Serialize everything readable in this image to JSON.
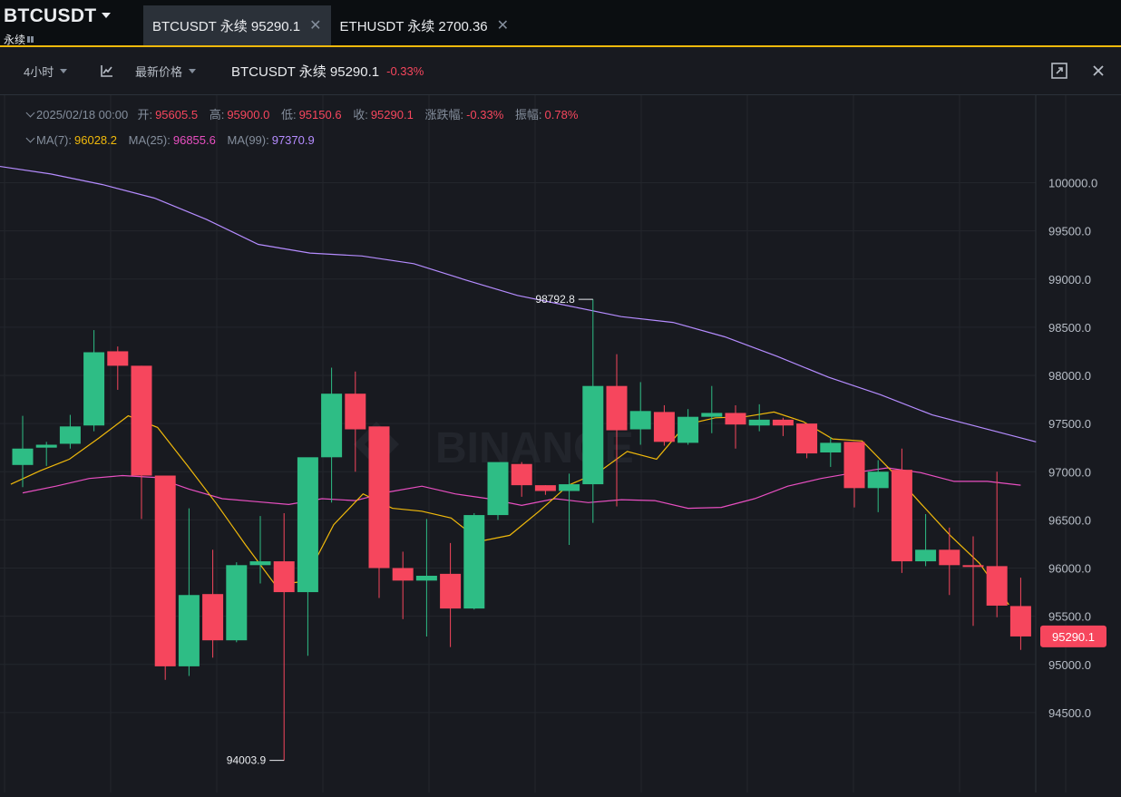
{
  "header": {
    "symbol": "BTCUSDT",
    "symbol_sub": "永续",
    "tabs": [
      {
        "label": "BTCUSDT 永续 95290.1",
        "active": true
      },
      {
        "label": "ETHUSDT 永续 2700.36",
        "active": false
      }
    ],
    "close_glyph": "✕"
  },
  "toolbar": {
    "interval": "4小时",
    "price_type": "最新价格",
    "title": "BTCUSDT 永续 95290.1",
    "change": "-0.33%"
  },
  "ohlc": {
    "date": "2025/02/18 00:00",
    "open_label": "开:",
    "open": "95605.5",
    "high_label": "高:",
    "high": "95900.0",
    "low_label": "低:",
    "low": "95150.6",
    "close_label": "收:",
    "close": "95290.1",
    "change_label": "涨跌幅:",
    "change": "-0.33%",
    "amplitude_label": "振幅:",
    "amplitude": "0.78%"
  },
  "ma": {
    "ma7_label": "MA(7):",
    "ma7": "96028.2",
    "ma25_label": "MA(25):",
    "ma25": "96855.6",
    "ma99_label": "MA(99):",
    "ma99": "97370.9"
  },
  "watermark": "BINANCE",
  "colors": {
    "up": "#2ebd85",
    "down": "#f6465d",
    "ma7": "#f0b90b",
    "ma25": "#e84fc1",
    "ma99": "#b58cff",
    "accent": "#f0b90b"
  },
  "chart_data": {
    "type": "candlestick",
    "ylim": [
      94000,
      100400
    ],
    "y_ticks": [
      "100000.0",
      "99500.0",
      "99000.0",
      "98500.0",
      "98000.0",
      "97500.0",
      "97000.0",
      "96500.0",
      "96000.0",
      "95500.0",
      "95000.0",
      "94500.0"
    ],
    "last_price": "95290.1",
    "annotations": {
      "high": "98792.8",
      "low": "94003.9"
    },
    "candles": [
      {
        "o": 97070,
        "h": 97580,
        "l": 96840,
        "c": 97240
      },
      {
        "o": 97250,
        "h": 97310,
        "l": 97060,
        "c": 97280
      },
      {
        "o": 97290,
        "h": 97590,
        "l": 97240,
        "c": 97470
      },
      {
        "o": 97480,
        "h": 98470,
        "l": 97420,
        "c": 98240
      },
      {
        "o": 98250,
        "h": 98300,
        "l": 97850,
        "c": 98100
      },
      {
        "o": 98100,
        "h": 98100,
        "l": 96510,
        "c": 96960
      },
      {
        "o": 96960,
        "h": 96960,
        "l": 94840,
        "c": 94980
      },
      {
        "o": 94980,
        "h": 96620,
        "l": 94880,
        "c": 95720
      },
      {
        "o": 95730,
        "h": 96190,
        "l": 95070,
        "c": 95250
      },
      {
        "o": 95250,
        "h": 96060,
        "l": 95230,
        "c": 96030
      },
      {
        "o": 96030,
        "h": 96540,
        "l": 95840,
        "c": 96070
      },
      {
        "o": 96070,
        "h": 96570,
        "l": 94004,
        "c": 95750
      },
      {
        "o": 95750,
        "h": 96520,
        "l": 95090,
        "c": 97150
      },
      {
        "o": 97150,
        "h": 98080,
        "l": 96680,
        "c": 97810
      },
      {
        "o": 97810,
        "h": 98040,
        "l": 97000,
        "c": 97440
      },
      {
        "o": 97470,
        "h": 97470,
        "l": 95690,
        "c": 96000
      },
      {
        "o": 96000,
        "h": 96170,
        "l": 95470,
        "c": 95870
      },
      {
        "o": 95870,
        "h": 96510,
        "l": 95290,
        "c": 95920
      },
      {
        "o": 95940,
        "h": 96260,
        "l": 95180,
        "c": 95580
      },
      {
        "o": 95580,
        "h": 96570,
        "l": 95570,
        "c": 96550
      },
      {
        "o": 96550,
        "h": 97080,
        "l": 96500,
        "c": 97100
      },
      {
        "o": 97080,
        "h": 97100,
        "l": 96740,
        "c": 96860
      },
      {
        "o": 96860,
        "h": 96860,
        "l": 96760,
        "c": 96800
      },
      {
        "o": 96800,
        "h": 96980,
        "l": 96240,
        "c": 96870
      },
      {
        "o": 96870,
        "h": 98790,
        "l": 96470,
        "c": 97890
      },
      {
        "o": 97890,
        "h": 98220,
        "l": 96640,
        "c": 97430
      },
      {
        "o": 97440,
        "h": 97930,
        "l": 97280,
        "c": 97630
      },
      {
        "o": 97620,
        "h": 97690,
        "l": 97270,
        "c": 97310
      },
      {
        "o": 97300,
        "h": 97650,
        "l": 97280,
        "c": 97570
      },
      {
        "o": 97570,
        "h": 97890,
        "l": 97400,
        "c": 97610
      },
      {
        "o": 97610,
        "h": 97690,
        "l": 97240,
        "c": 97490
      },
      {
        "o": 97480,
        "h": 97700,
        "l": 97420,
        "c": 97540
      },
      {
        "o": 97540,
        "h": 97560,
        "l": 97370,
        "c": 97480
      },
      {
        "o": 97500,
        "h": 97500,
        "l": 97140,
        "c": 97190
      },
      {
        "o": 97200,
        "h": 97360,
        "l": 97050,
        "c": 97300
      },
      {
        "o": 97310,
        "h": 97310,
        "l": 96630,
        "c": 96830
      },
      {
        "o": 96830,
        "h": 97120,
        "l": 96580,
        "c": 97000
      },
      {
        "o": 97020,
        "h": 97240,
        "l": 95950,
        "c": 96070
      },
      {
        "o": 96070,
        "h": 96560,
        "l": 96020,
        "c": 96190
      },
      {
        "o": 96190,
        "h": 96420,
        "l": 95720,
        "c": 96030
      },
      {
        "o": 96030,
        "h": 96330,
        "l": 95400,
        "c": 96020
      },
      {
        "o": 96020,
        "h": 97000,
        "l": 95490,
        "c": 95610
      },
      {
        "o": 95605.5,
        "h": 95900,
        "l": 95150.6,
        "c": 95290.1
      }
    ],
    "ma7": [
      96870,
      97010,
      97130,
      97350,
      97580,
      97460,
      97070,
      96670,
      96240,
      95830,
      95860,
      96450,
      96770,
      96620,
      96590,
      96520,
      96280,
      96340,
      96590,
      96860,
      96990,
      97210,
      97130,
      97490,
      97560,
      97570,
      97620,
      97520,
      97340,
      97320,
      97010,
      96670,
      96340,
      96050,
      95620
    ],
    "ma25": [
      96780,
      96850,
      96930,
      96960,
      96940,
      96820,
      96720,
      96690,
      96660,
      96720,
      96700,
      96790,
      96850,
      96770,
      96720,
      96650,
      96720,
      96680,
      96710,
      96700,
      96620,
      96630,
      96720,
      96850,
      96930,
      96990,
      97040,
      96990,
      96900,
      96900,
      96860
    ],
    "ma99": [
      100170,
      100090,
      99980,
      99840,
      99620,
      99360,
      99270,
      99240,
      99160,
      98990,
      98830,
      98720,
      98610,
      98550,
      98400,
      98200,
      97980,
      97800,
      97590,
      97450,
      97310
    ]
  }
}
